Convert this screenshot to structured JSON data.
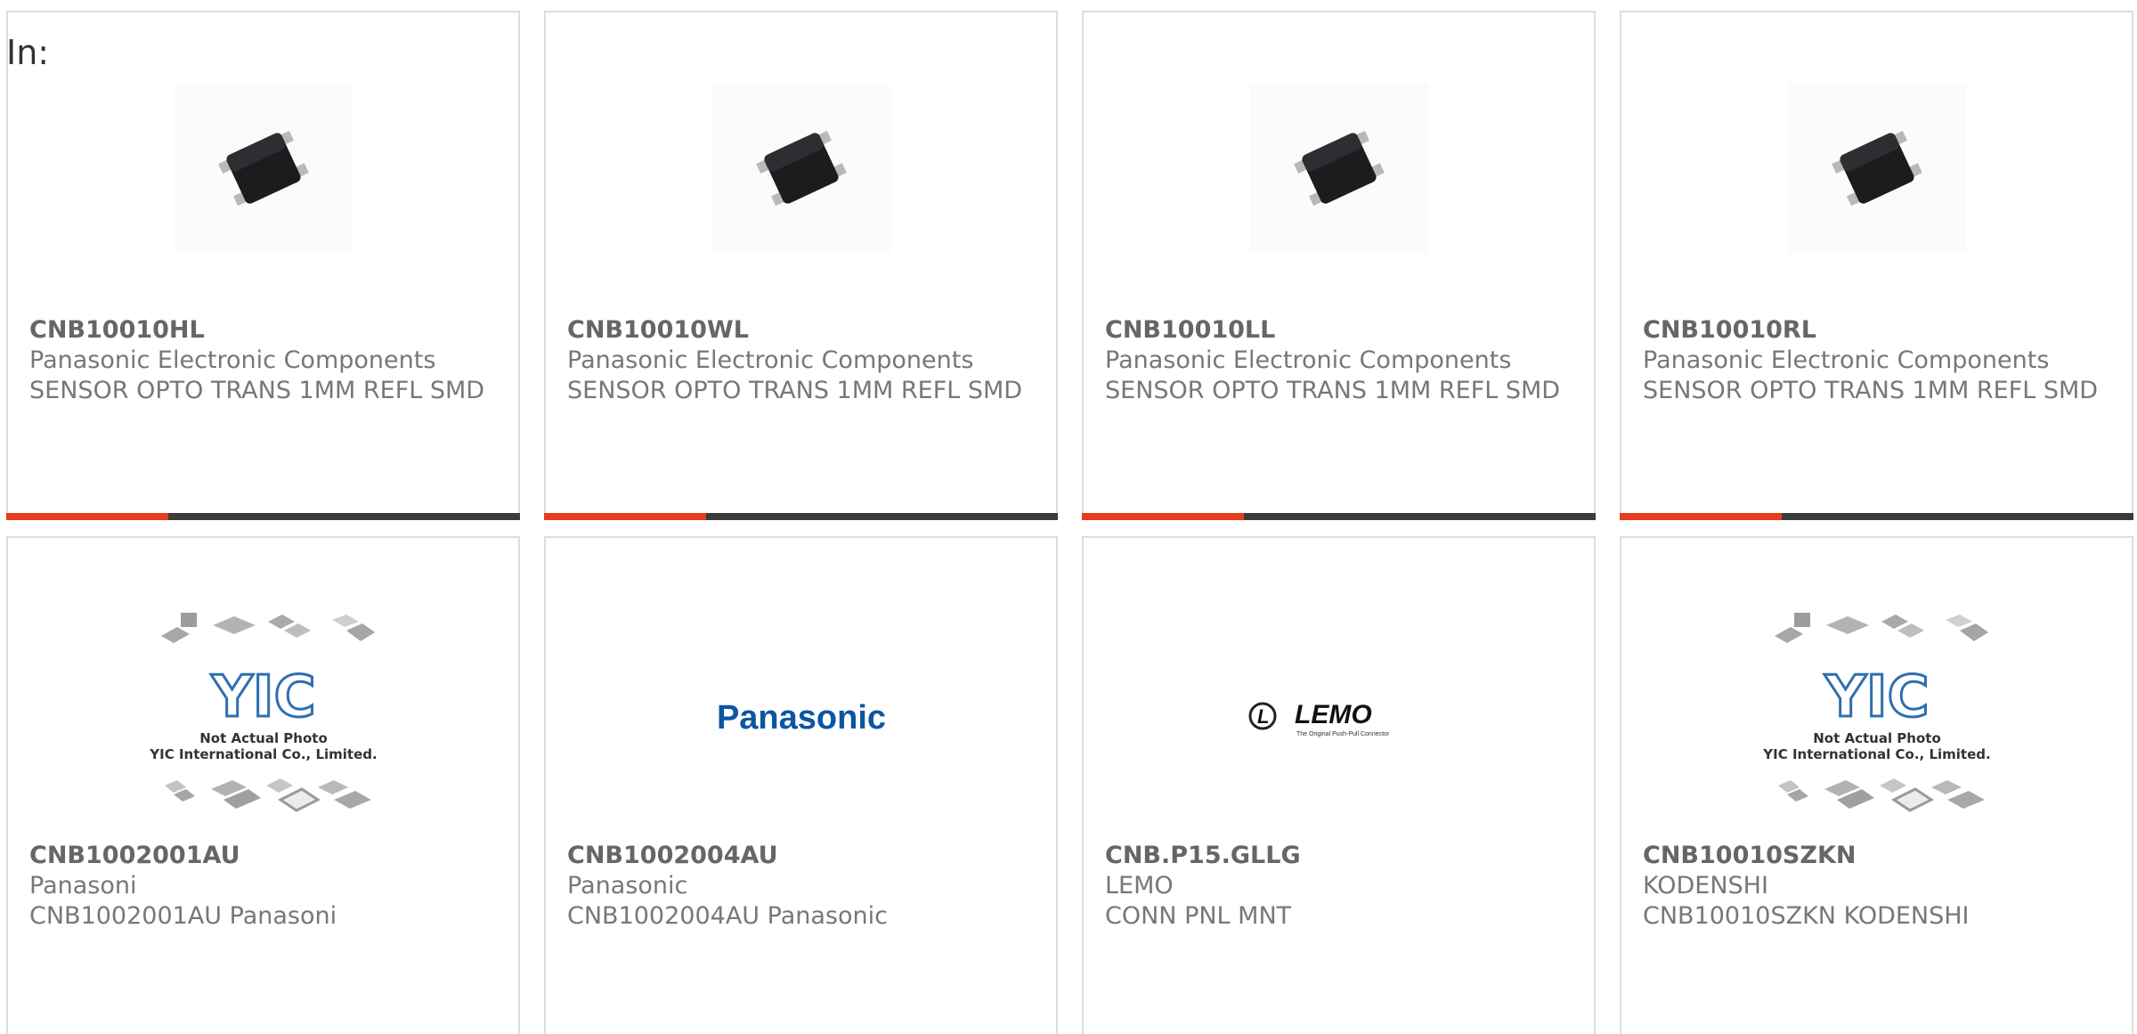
{
  "filter": {
    "label": "In:"
  },
  "colors": {
    "accent": "#e63c1e",
    "bar": "#3c3c3c",
    "border": "#dddddd",
    "text": "#777777"
  },
  "products": [
    {
      "part": "CNB10010HL",
      "manufacturer": "Panasonic Electronic Components",
      "description": "SENSOR OPTO TRANS 1MM REFL SMD",
      "image": "sensor-photo"
    },
    {
      "part": "CNB10010WL",
      "manufacturer": "Panasonic Electronic Components",
      "description": "SENSOR OPTO TRANS 1MM REFL SMD",
      "image": "sensor-photo"
    },
    {
      "part": "CNB10010LL",
      "manufacturer": "Panasonic Electronic Components",
      "description": "SENSOR OPTO TRANS 1MM REFL SMD",
      "image": "sensor-photo"
    },
    {
      "part": "CNB10010RL",
      "manufacturer": "Panasonic Electronic Components",
      "description": "SENSOR OPTO TRANS 1MM REFL SMD",
      "image": "sensor-photo"
    },
    {
      "part": "CNB1002001AU",
      "manufacturer": "Panasoni",
      "description": "CNB1002001AU Panasoni",
      "image": "placeholder-photo",
      "placeholder": {
        "logo": "YIC",
        "line1": "Not Actual Photo",
        "line2": "YIC International Co., Limited."
      }
    },
    {
      "part": "CNB1002004AU",
      "manufacturer": "Panasonic",
      "description": "CNB1002004AU Panasonic",
      "image": "panasonic-logo",
      "logo_text": "Panasonic"
    },
    {
      "part": "CNB.P15.GLLG",
      "manufacturer": "LEMO",
      "description": "CONN PNL MNT",
      "image": "lemo-logo",
      "logo_text": "LEMO",
      "logo_tagline": "The Original Push-Pull Connector"
    },
    {
      "part": "CNB10010SZKN",
      "manufacturer": "KODENSHI",
      "description": "CNB10010SZKN KODENSHI",
      "image": "placeholder-photo",
      "placeholder": {
        "logo": "YIC",
        "line1": "Not Actual Photo",
        "line2": "YIC International Co., Limited."
      }
    }
  ]
}
